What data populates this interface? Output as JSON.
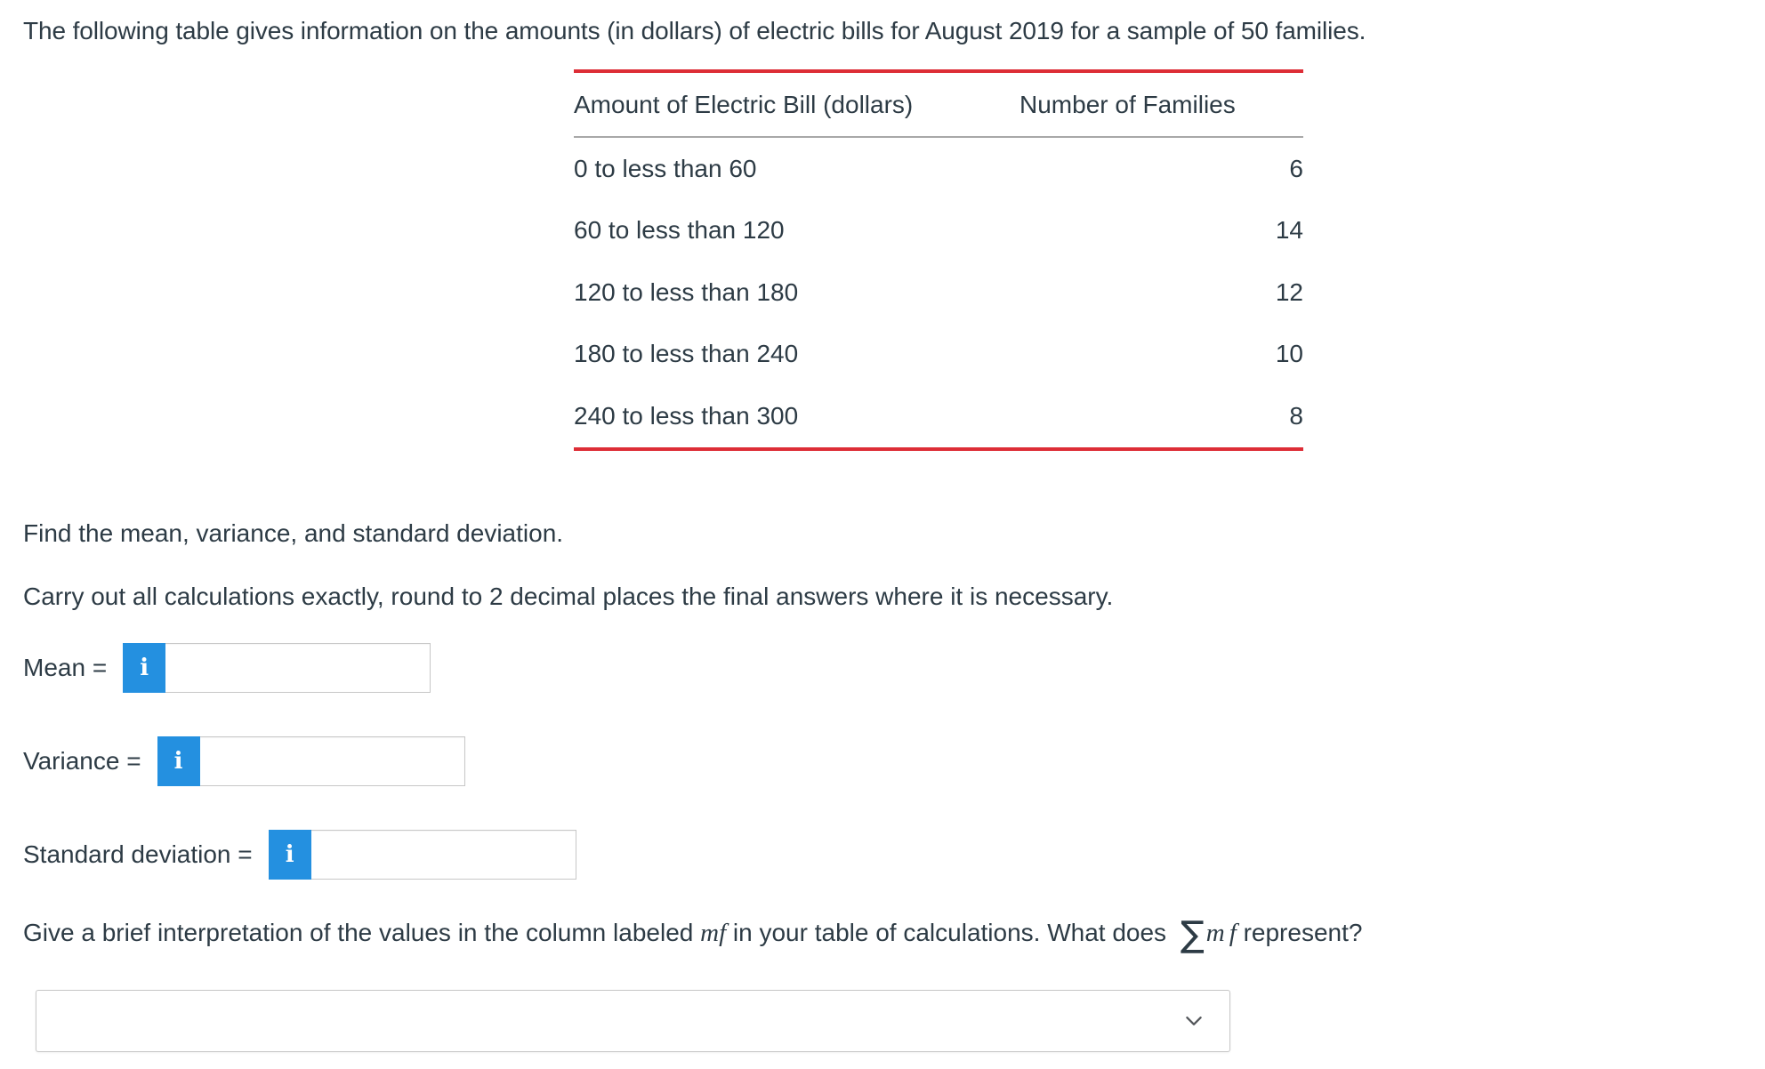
{
  "intro": {
    "text": "The following table gives information on the amounts (in dollars) of electric bills for August 2019 for a sample of 50 families."
  },
  "table": {
    "headers": {
      "bill": "Amount of Electric Bill (dollars)",
      "families": "Number of Families"
    },
    "rows": [
      {
        "bill": "0 to less than 60",
        "families": "6"
      },
      {
        "bill": "60 to less than 120",
        "families": "14"
      },
      {
        "bill": "120 to less than 180",
        "families": "12"
      },
      {
        "bill": "180 to less than 240",
        "families": "10"
      },
      {
        "bill": "240 to less than 300",
        "families": "8"
      }
    ],
    "border_color_top": "#dd2d36",
    "border_color_bottom": "#dd2d36",
    "border_color_header_rule": "#a8a8a8"
  },
  "prompts": {
    "find": "Find the mean, variance, and standard deviation.",
    "round": "Carry out all calculations exactly, round to 2 decimal places the final answers where it is necessary."
  },
  "answers": {
    "info_icon_glyph": "i",
    "info_icon_color": "#2490e0",
    "mean": {
      "label": "Mean =",
      "value": "",
      "placeholder": ""
    },
    "variance": {
      "label": "Variance =",
      "value": "",
      "placeholder": ""
    },
    "stddev": {
      "label": "Standard deviation =",
      "value": "",
      "placeholder": ""
    }
  },
  "final_question": {
    "part1": "Give a brief interpretation of the values in the column labeled ",
    "mf_inline": "mf",
    "part2": " in your table of calculations. What does ",
    "sigma": "∑",
    "mf_math_m": "m",
    "mf_math_f": "f",
    "part3": " represent?"
  },
  "dropdown": {
    "selected": "",
    "options": [
      ""
    ],
    "icon": "chevron-down-icon"
  },
  "colors": {
    "text": "#2d3b45",
    "accent_blue": "#2490e0",
    "accent_red": "#dd2d36",
    "input_border": "#c7c7c7"
  }
}
